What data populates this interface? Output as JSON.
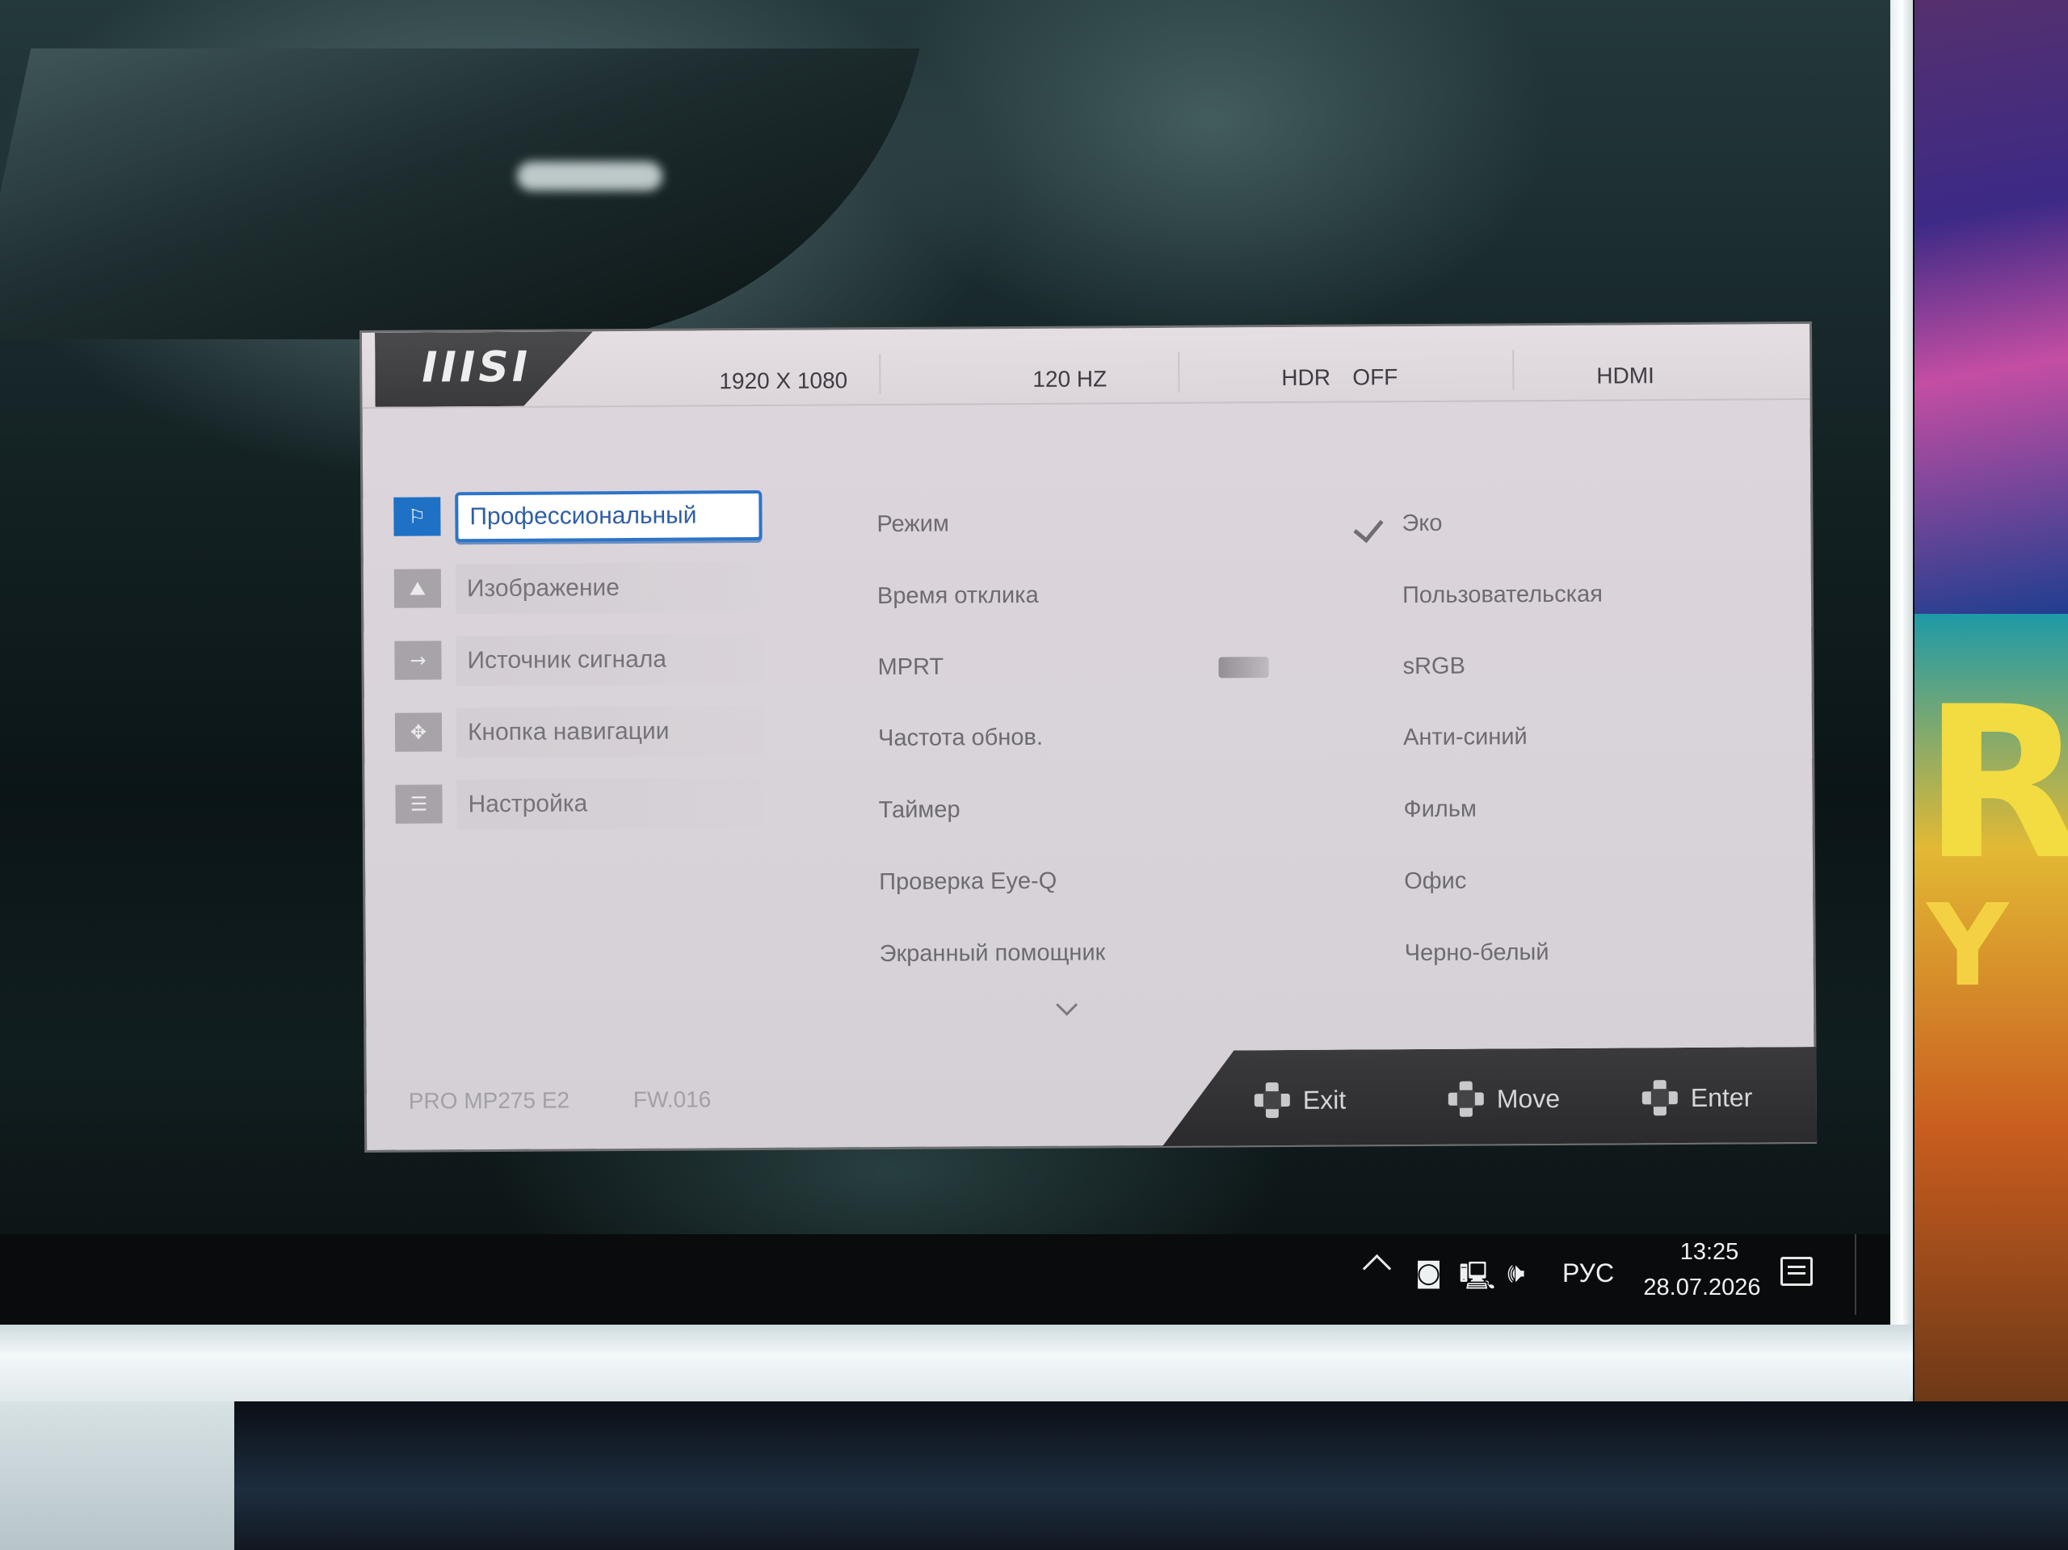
{
  "osd": {
    "brand": "msi",
    "status": {
      "resolution": "1920 X 1080",
      "refresh": "120 HZ",
      "hdr_label": "HDR",
      "hdr_value": "OFF",
      "input": "HDMI"
    },
    "nav": [
      {
        "label": "Профессиональный",
        "icon": "flag-icon",
        "active": true
      },
      {
        "label": "Изображение",
        "icon": "image-icon",
        "active": false
      },
      {
        "label": "Источник сигнала",
        "icon": "input-arrow-icon",
        "active": false
      },
      {
        "label": "Кнопка навигации",
        "icon": "navigation-key-icon",
        "active": false
      },
      {
        "label": "Настройка",
        "icon": "sliders-icon",
        "active": false
      }
    ],
    "settings": [
      "Режим",
      "Время отклика",
      "MPRT",
      "Частота обнов.",
      "Таймер",
      "Проверка Eye-Q",
      "Экранный помощник"
    ],
    "options": [
      {
        "label": "Эко",
        "selected": true
      },
      {
        "label": "Пользовательская",
        "selected": false
      },
      {
        "label": "sRGB",
        "selected": false
      },
      {
        "label": "Анти-синий",
        "selected": false
      },
      {
        "label": "Фильм",
        "selected": false
      },
      {
        "label": "Офис",
        "selected": false
      },
      {
        "label": "Черно-белый",
        "selected": false
      }
    ],
    "footer": {
      "model": "PRO MP275 E2",
      "firmware": "FW.016",
      "hints": {
        "exit": "Exit",
        "move": "Move",
        "enter": "Enter"
      }
    },
    "colors": {
      "accent": "#2d74c9",
      "panel": "#dcd6db",
      "footer_bar": "#2f2f32"
    }
  },
  "taskbar": {
    "language": "РУС",
    "time": "13:25",
    "date": "28.07.2026",
    "tray_icons": [
      "chevron-up-icon",
      "webcam-icon",
      "network-icon",
      "volume-icon",
      "notification-icon"
    ]
  }
}
